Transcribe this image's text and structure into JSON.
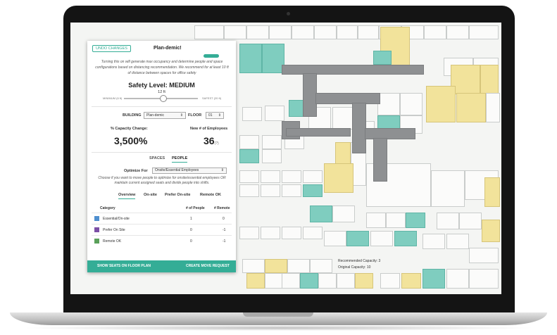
{
  "panel": {
    "undo_label": "UNDO CHANGES",
    "title": "Plan-demic!",
    "description": "Turning this on will generate max occupancy and determine people and space configurations based on distancing recommendation. We recommend for at least 10 ft of distance between spaces for office safety",
    "safety_level": "Safety Level: MEDIUM",
    "distance": "12 ft",
    "slider": {
      "min_label": "MINIMUM (6 ft)",
      "max_label": "SAFEST (20 ft)",
      "value_fraction": 0.5
    },
    "building_label": "BUILDING",
    "building_value": "Plan-demic",
    "floor_label": "FLOOR",
    "floor_value": "01",
    "capacity_change_label": "% Capacity Change:",
    "capacity_change_value": "3,500%",
    "new_employees_label": "New # of Employees",
    "new_employees_value": "36",
    "new_employees_suffix": "(?)",
    "tabs": [
      "SPACES",
      "PEOPLE"
    ],
    "optimize_label": "Optimize For",
    "optimize_value": "Onsite/Essential Employees",
    "optimize_desc": "Choose if you want to move people to optimize for onsite/essential employees OR maintain current assigned seats and divide people into shifts.",
    "subtabs": [
      "Overview",
      "On-site",
      "Prefer On-site",
      "Remote OK"
    ],
    "table": {
      "headers": [
        "Category",
        "# of People",
        "# Remote"
      ],
      "rows": [
        {
          "name": "Essential/On-site",
          "people": "1",
          "remote": "0",
          "color": "#4f8fcf"
        },
        {
          "name": "Prefer On Site",
          "people": "0",
          "remote": "-1",
          "color": "#7b4fa6"
        },
        {
          "name": "Remote OK",
          "people": "0",
          "remote": "-1",
          "color": "#5aa05a"
        }
      ]
    },
    "footer_left": "SHOW SEATS ON FLOOR PLAN",
    "footer_right": "CREATE MOVE REQUEST"
  },
  "plan": {
    "recommended": "Recommended Capacity: 3",
    "original": "Original Capacity: 10",
    "colors": {
      "teal": "#7fcdbf",
      "yellow": "#f2e39b",
      "corridor": "#8e9092"
    }
  },
  "accent": "#34ad96"
}
